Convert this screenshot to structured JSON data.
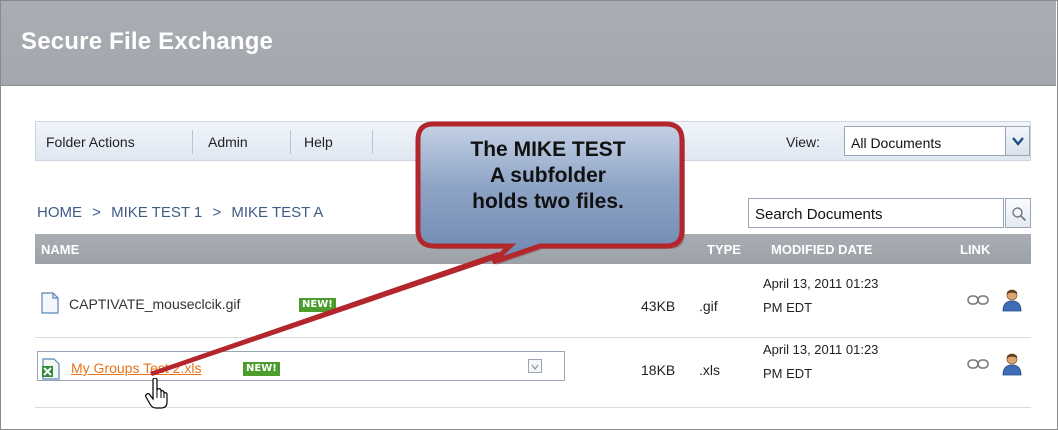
{
  "header": {
    "title": "Secure File Exchange"
  },
  "toolbar": {
    "items": [
      "Folder Actions",
      "Admin",
      "Help"
    ],
    "view_label": "View:",
    "view_value": "All Documents"
  },
  "breadcrumb": [
    "HOME",
    ">",
    "MIKE TEST 1",
    ">",
    "MIKE TEST A"
  ],
  "search": {
    "placeholder": "Search Documents"
  },
  "table": {
    "columns": [
      "NAME",
      "TYPE",
      "MODIFIED DATE",
      "LINK"
    ],
    "rows": [
      {
        "name": "CAPTIVATE_mouseclcik.gif",
        "badge": "NEW!",
        "size": "43KB",
        "type": ".gif",
        "date_line1": "April 13, 2011 01:23",
        "date_line2": "PM EDT",
        "icon": "gif-file-icon"
      },
      {
        "name": "My Groups Test 2.xls",
        "badge": "NEW!",
        "size": "18KB",
        "type": ".xls",
        "date_line1": "April 13, 2011 01:23",
        "date_line2": "PM EDT",
        "icon": "excel-file-icon"
      }
    ]
  },
  "callout": {
    "lines": [
      "The MIKE TEST",
      "A subfolder",
      "holds two files."
    ]
  },
  "colors": {
    "header_bg": "#a6abb1",
    "link_orange": "#e8731e",
    "badge_green": "#4c9c2e",
    "callout_border": "#b2262c",
    "callout_fill": "#8fa4c4"
  }
}
